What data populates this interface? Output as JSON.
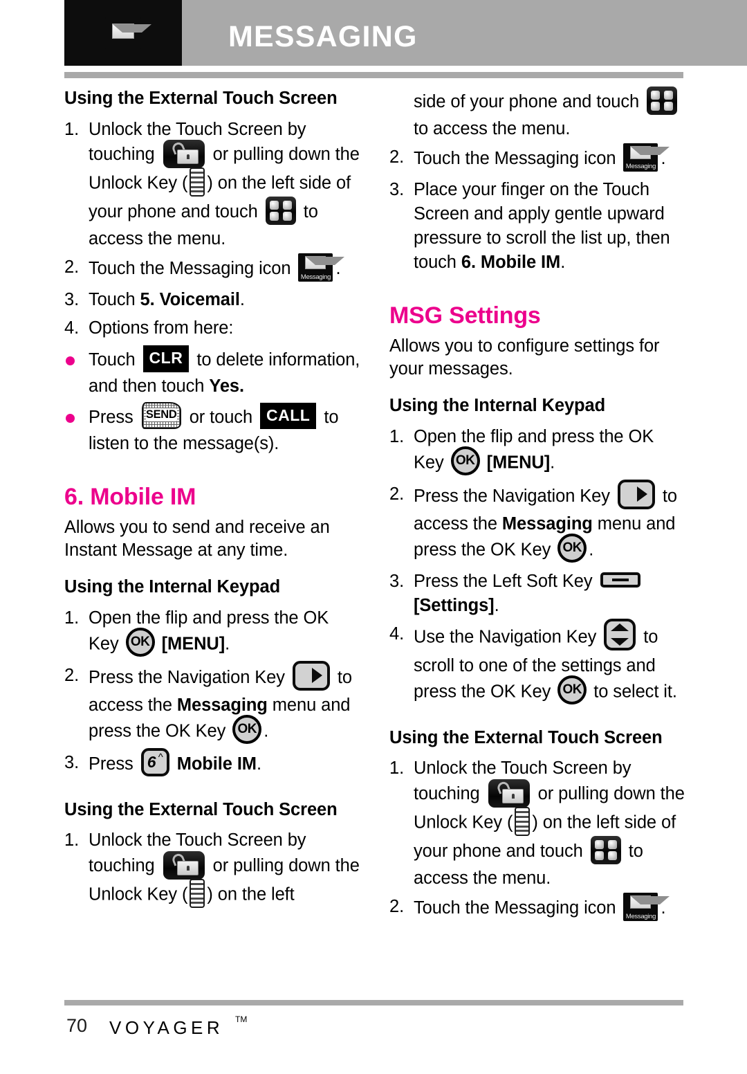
{
  "header": {
    "title": "MESSAGING",
    "icon": "envelope-icon"
  },
  "left_column": {
    "s1_heading": "Using the External Touch Screen",
    "s1_steps": [
      {
        "num": "1.",
        "pre": "Unlock the Touch Screen by touching",
        "mid": "or pulling down the Unlock Key (",
        "mid2": ") on the left side of your phone and touch",
        "post": "to access the menu."
      },
      {
        "num": "2.",
        "pre": "Touch the Messaging icon",
        "post": "."
      },
      {
        "num": "3.",
        "pre": "Touch ",
        "bold": "5. Voicemail",
        "post": "."
      },
      {
        "num": "4.",
        "pre": "Options from here:"
      }
    ],
    "bullets": [
      {
        "pre": "Touch",
        "chip": "CLR",
        "mid": "to delete information, and then touch ",
        "bold": "Yes.",
        "post": ""
      },
      {
        "pre": "Press",
        "mid": "or touch",
        "chip": "CALL",
        "post": "to listen to the message(s)."
      }
    ],
    "s2_title": "6. Mobile IM",
    "s2_desc": "Allows you to send and receive an Instant Message at any time.",
    "s3_heading": "Using the Internal Keypad",
    "s3_steps": [
      {
        "num": "1.",
        "pre": "Open the flip and press the OK Key",
        "post": " ",
        "bold": "[MENU]",
        "tail": "."
      },
      {
        "num": "2.",
        "pre": "Press the Navigation Key",
        "mid": "to access the ",
        "bold": "Messaging",
        "mid2": " menu and press the OK Key",
        "post": "."
      },
      {
        "num": "3.",
        "pre": "Press",
        "bold": "Mobile IM",
        "post": "."
      }
    ],
    "s4_heading": "Using the External Touch Screen",
    "s4_steps": [
      {
        "num": "1.",
        "pre": "Unlock the Touch Screen by touching",
        "mid": "or pulling down the Unlock Key (",
        "post": ") on the left"
      }
    ]
  },
  "right_column": {
    "s1_cont_line1": "side of your phone and touch",
    "s1_cont_line2": "to access the menu.",
    "s1_steps": [
      {
        "num": "2.",
        "pre": "Touch the Messaging icon",
        "post": "."
      },
      {
        "num": "3.",
        "pre": "Place your finger on the Touch Screen and apply gentle upward pressure to scroll the list up, then touch ",
        "bold": "6. Mobile IM",
        "post": "."
      }
    ],
    "s2_title": "MSG Settings",
    "s2_desc": "Allows you to configure settings for your messages.",
    "s3_heading": "Using the Internal Keypad",
    "s3_steps": [
      {
        "num": "1.",
        "pre": "Open the flip and press the OK Key",
        "bold": "[MENU]",
        "tail": "."
      },
      {
        "num": "2.",
        "pre": "Press the Navigation Key",
        "mid": "to access the ",
        "bold": "Messaging",
        "mid2": " menu and press the OK Key",
        "post": "."
      },
      {
        "num": "3.",
        "pre": "Press the Left Soft Key",
        "bold": "[Settings]",
        "post": "."
      },
      {
        "num": "4.",
        "pre": "Use the Navigation Key",
        "mid": "to scroll to one of the settings and press the OK Key",
        "post": "to select it."
      }
    ],
    "s4_heading": "Using the External Touch Screen",
    "s4_steps": [
      {
        "num": "1.",
        "pre": "Unlock the Touch Screen by touching",
        "mid": "or pulling down the Unlock Key (",
        "mid2": ") on the left side of your phone and touch",
        "post": "to access the menu."
      },
      {
        "num": "2.",
        "pre": "Touch the Messaging icon",
        "post": "."
      }
    ]
  },
  "icons": {
    "unlock_tile": "unlock-padlock-icon",
    "unlock_key": "unlock-key-icon",
    "grid_menu": "grid-menu-icon",
    "messaging_tile": "messaging-app-icon",
    "messaging_label": "Messaging",
    "clr_chip": "CLR",
    "call_chip": "CALL",
    "send_key": "SEND",
    "ok_key": "OK",
    "num_key_digit": "6",
    "num_key_caret": "^",
    "nav_key_right": "navigation-key-right-icon",
    "nav_key_updown": "navigation-key-updown-icon",
    "left_soft_key": "left-soft-key-icon"
  },
  "footer": {
    "page_number": "70",
    "brand": "VOYAGER",
    "trademark": "TM"
  }
}
